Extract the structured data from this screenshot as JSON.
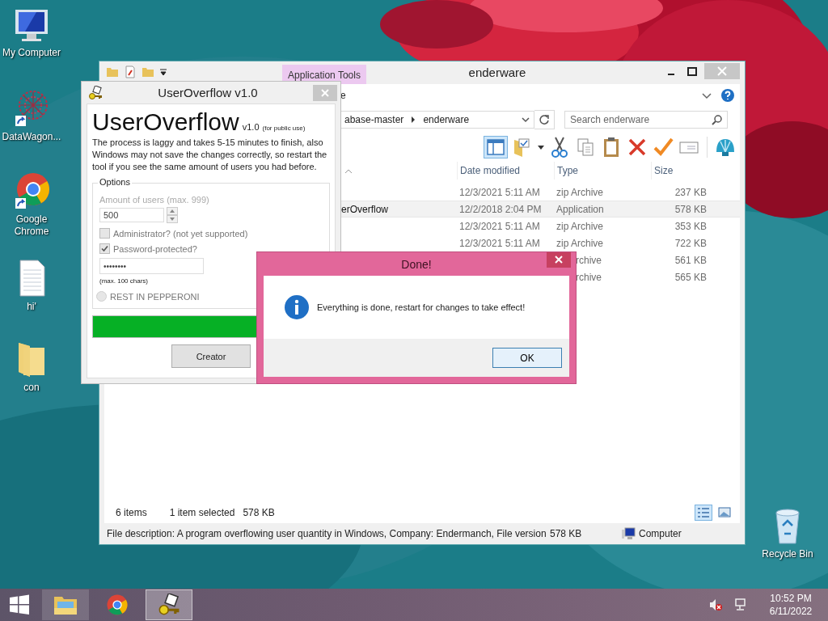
{
  "desktop_icons": [
    {
      "label": "My Computer",
      "kind": "computer",
      "shortcut": false
    },
    {
      "label": "DataWagon...",
      "kind": "graph",
      "shortcut": true
    },
    {
      "label": "Google Chrome",
      "kind": "browser",
      "shortcut": true
    },
    {
      "label": "hi'",
      "kind": "document",
      "shortcut": false
    },
    {
      "label": "con",
      "kind": "folder",
      "shortcut": false
    },
    {
      "label": "Recycle Bin",
      "kind": "bin",
      "shortcut": false
    }
  ],
  "explorer": {
    "title": "enderware",
    "context_tab": "Application Tools",
    "ribbon_fragment": "e",
    "breadcrumb": [
      "abase-master",
      "enderware"
    ],
    "search": {
      "placeholder": "Search enderware"
    },
    "columns": [
      "Date modified",
      "Type",
      "Size"
    ],
    "rows": [
      {
        "date": "12/3/2021 5:11 AM",
        "type": "zip Archive",
        "size": "237 KB",
        "selected": false
      },
      {
        "name": "erOverflow",
        "date": "12/2/2018 2:04 PM",
        "type": "Application",
        "size": "578 KB",
        "selected": true
      },
      {
        "date": "12/3/2021 5:11 AM",
        "type": "zip Archive",
        "size": "353 KB",
        "selected": false
      },
      {
        "date": "12/3/2021 5:11 AM",
        "type": "zip Archive",
        "size": "722 KB",
        "selected": false
      },
      {
        "type": "rchive",
        "size": "561 KB",
        "selected": false
      },
      {
        "type": "rchive",
        "size": "565 KB",
        "selected": false
      }
    ],
    "status": {
      "count": "6 items",
      "selection": "1 item selected",
      "selection_size": "578 KB"
    },
    "view_buttons": [
      {
        "kind": "details",
        "selected": true
      },
      {
        "kind": "icons",
        "selected": false
      }
    ],
    "details_bar": {
      "description": "File description: A program overflowing user quantity in Windows, Company: Endermanch, File version",
      "size": "578 KB",
      "location": "Computer"
    }
  },
  "app": {
    "title": "UserOverflow v1.0",
    "heading": "UserOverflow",
    "version": "v1.0",
    "edition": "(for public use)",
    "note": "The process is laggy and takes 5-15 minutes to finish, also Windows may not save the changes correctly, so restart the tool if you see the same amount of users you had before.",
    "options_label": "Options",
    "amount_label": "Amount of users (max. 999)",
    "amount_value": "500",
    "checkboxes": [
      {
        "label": "Administrator? (not yet supported)",
        "checked": false
      },
      {
        "label": "Password-protected?",
        "checked": true
      }
    ],
    "password_value": "••••••••",
    "password_hint": "(max. 100 chars)",
    "radio": {
      "label": "REST IN PEPPERONI",
      "selected": false
    },
    "button": "Creator"
  },
  "dialog": {
    "title": "Done!",
    "message": "Everything is done, restart for changes to take effect!",
    "button": "OK"
  },
  "taskbar": {
    "apps": [
      {
        "kind": "explorer",
        "selected": false
      },
      {
        "kind": "browser",
        "selected": false
      },
      {
        "kind": "keys",
        "selected": true
      }
    ],
    "time": "10:52 PM",
    "date": "6/11/2022"
  }
}
